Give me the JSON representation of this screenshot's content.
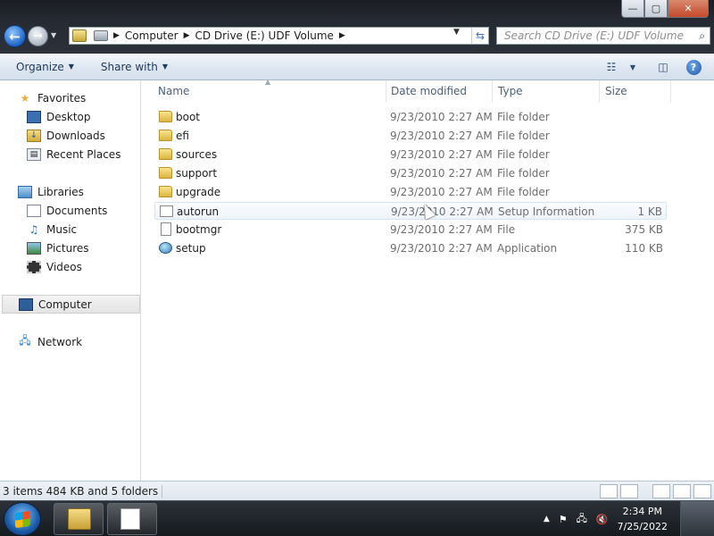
{
  "window": {
    "controls": {
      "minimize": "—",
      "maximize": "▢",
      "close": "✕"
    }
  },
  "nav": {
    "back_icon": "arrow-left-icon",
    "forward_icon": "arrow-right-icon"
  },
  "address": {
    "segments": [
      "Computer",
      "CD Drive (E:) UDF Volume"
    ]
  },
  "search": {
    "placeholder": "Search CD Drive (E:) UDF Volume"
  },
  "toolbar": {
    "organize_label": "Organize",
    "share_label": "Share with"
  },
  "sidebar": {
    "favorites": {
      "label": "Favorites",
      "items": [
        "Desktop",
        "Downloads",
        "Recent Places"
      ]
    },
    "libraries": {
      "label": "Libraries",
      "items": [
        "Documents",
        "Music",
        "Pictures",
        "Videos"
      ]
    },
    "computer": "Computer",
    "network": "Network"
  },
  "columns": {
    "name": "Name",
    "date": "Date modified",
    "type": "Type",
    "size": "Size"
  },
  "files": [
    {
      "name": "boot",
      "date": "9/23/2010 2:27 AM",
      "type": "File folder",
      "size": "",
      "icon": "folder-icon"
    },
    {
      "name": "efi",
      "date": "9/23/2010 2:27 AM",
      "type": "File folder",
      "size": "",
      "icon": "folder-icon"
    },
    {
      "name": "sources",
      "date": "9/23/2010 2:27 AM",
      "type": "File folder",
      "size": "",
      "icon": "folder-icon"
    },
    {
      "name": "support",
      "date": "9/23/2010 2:27 AM",
      "type": "File folder",
      "size": "",
      "icon": "folder-icon"
    },
    {
      "name": "upgrade",
      "date": "9/23/2010 2:27 AM",
      "type": "File folder",
      "size": "",
      "icon": "folder-icon"
    },
    {
      "name": "autorun",
      "date": "9/23/2010 2:27 AM",
      "type": "Setup Information",
      "size": "1 KB",
      "icon": "setup-info-icon"
    },
    {
      "name": "bootmgr",
      "date": "9/23/2010 2:27 AM",
      "type": "File",
      "size": "375 KB",
      "icon": "file-icon"
    },
    {
      "name": "setup",
      "date": "9/23/2010 2:27 AM",
      "type": "Application",
      "size": "110 KB",
      "icon": "setup-app-icon"
    }
  ],
  "status": {
    "text": "3 items 484 KB and 5 folders"
  },
  "taskbar": {
    "time": "2:34 PM",
    "date": "7/25/2022"
  }
}
